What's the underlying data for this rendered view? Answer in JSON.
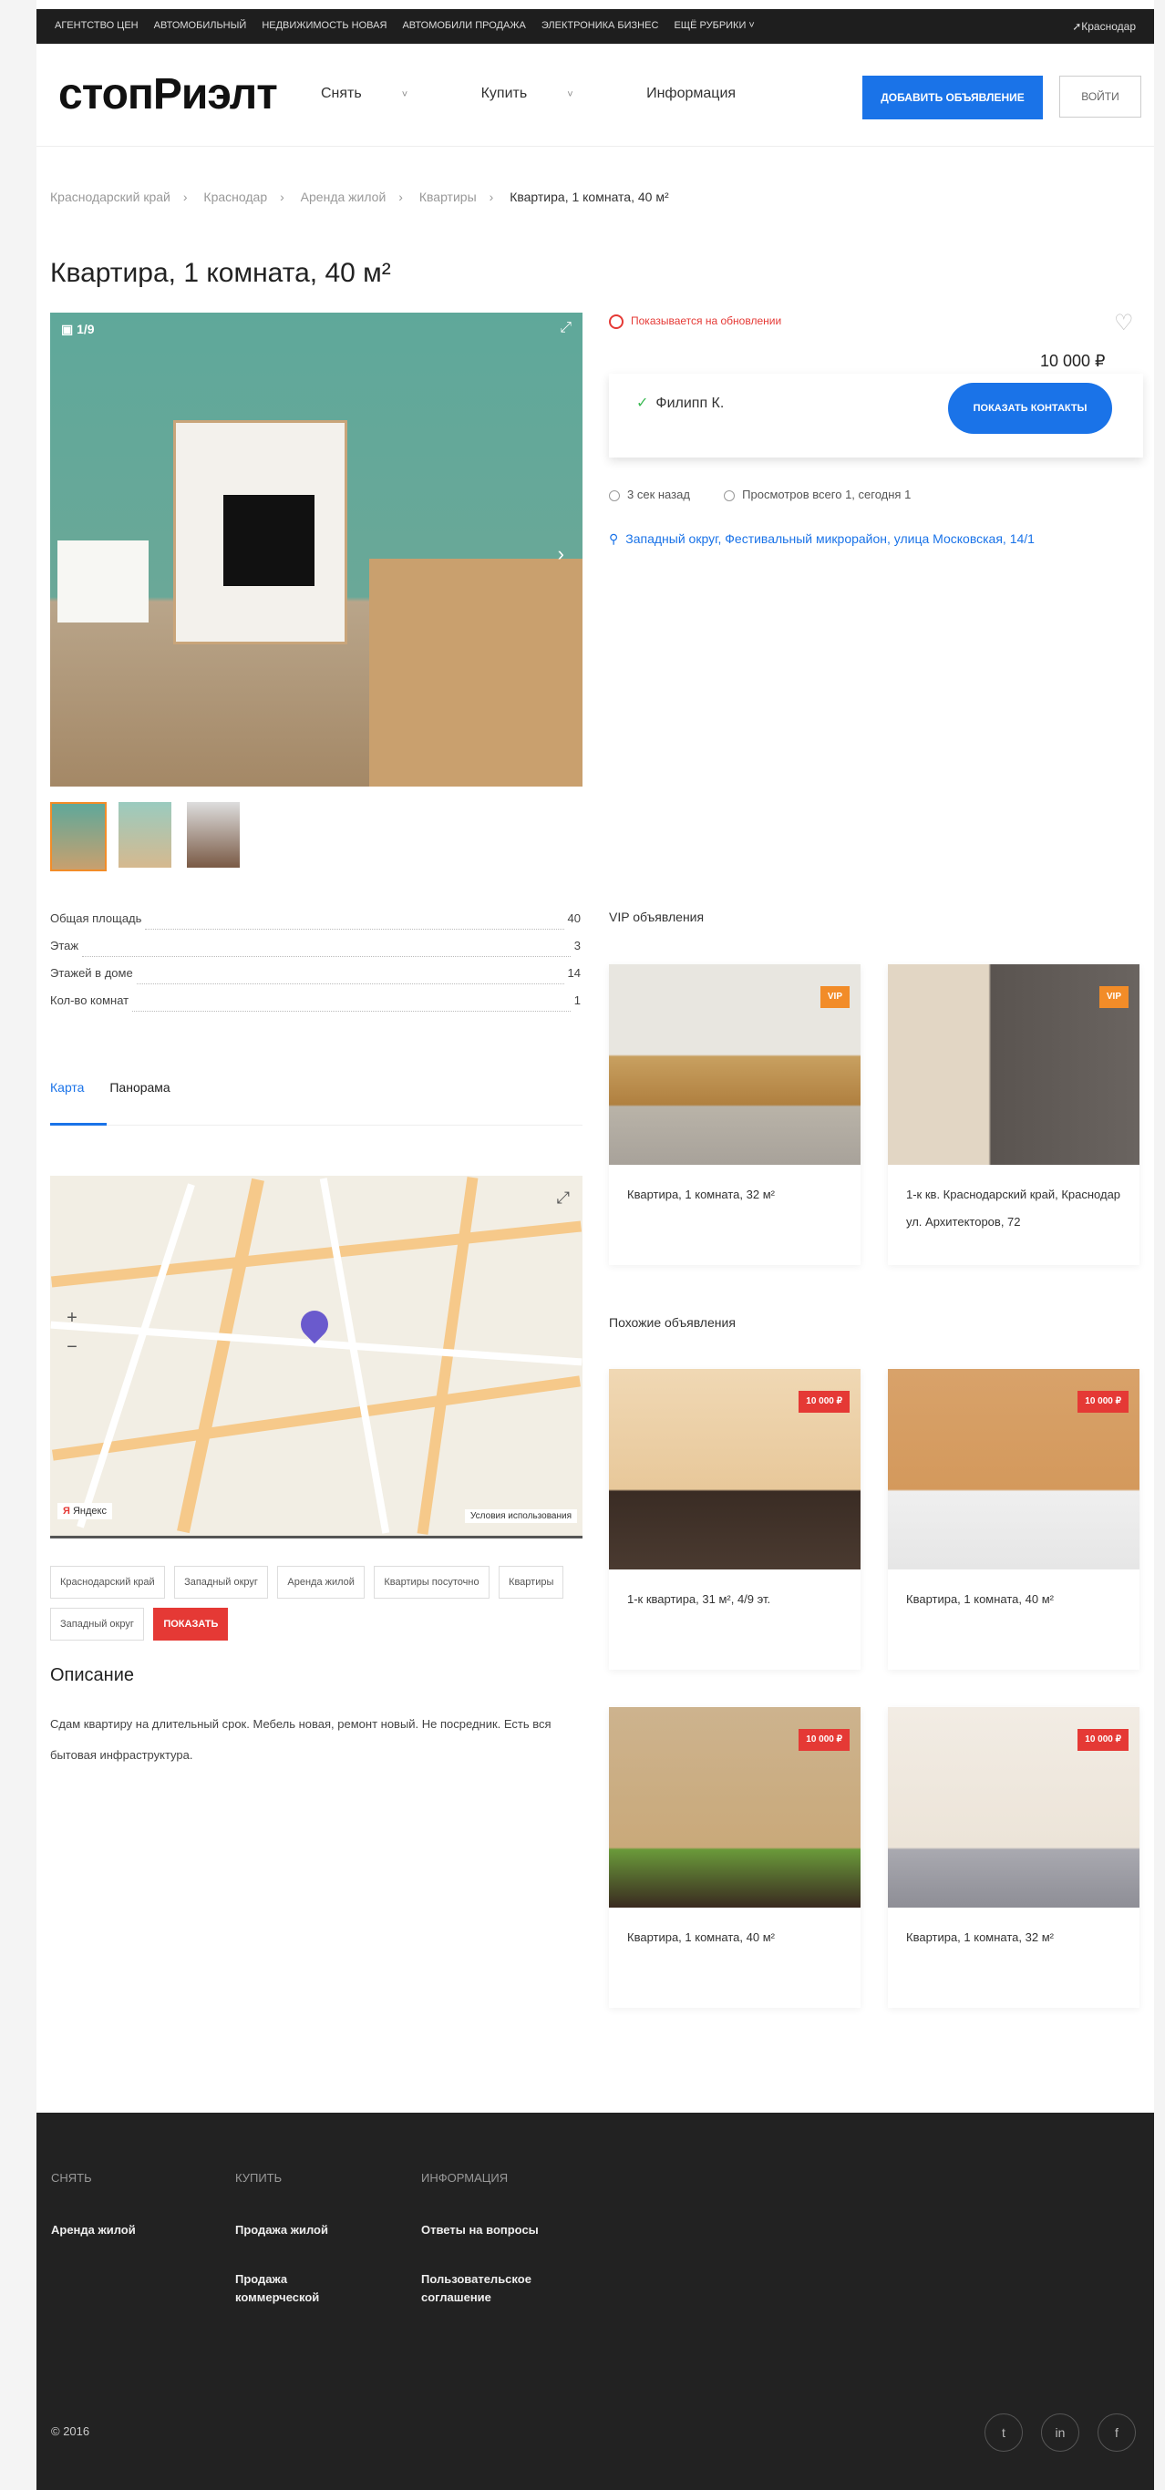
{
  "topbar": {
    "links": [
      "АГЕНТСТВО ЦЕН",
      "АВТОМОБИЛЬНЫЙ",
      "НЕДВИЖИМОСТЬ НОВАЯ",
      "АВТОМОБИЛИ ПРОДАЖА",
      "ЭЛЕКТРОНИКА БИЗНЕС",
      "ЕЩЁ РУБРИКИ ˅"
    ],
    "city": "Краснодар"
  },
  "header": {
    "logo": "стопРиэлт",
    "nav": [
      {
        "label": "Снять",
        "chevron": "˅"
      },
      {
        "label": "Купить",
        "chevron": "˅"
      },
      {
        "label": "Информация",
        "chevron": ""
      }
    ],
    "add_button": "ДОБАВИТЬ ОБЪЯВЛЕНИЕ",
    "login_button": "ВОЙТИ"
  },
  "breadcrumbs": [
    "Краснодарский край",
    "Краснодар",
    "Аренда жилой",
    "Квартиры",
    "Квартира, 1 комната, 40 м²"
  ],
  "listing": {
    "title": "Квартира, 1 комната, 40 м²",
    "photo_counter": "1/9",
    "status": "Показывается на обновлении",
    "price": "10 000 ₽",
    "seller": "Филипп К.",
    "contacts_button": "ПОКАЗАТЬ КОНТАКТЫ",
    "meta_views": "3 сек назад",
    "meta_published": "Просмотров всего 1, сегодня 1",
    "address": "Западный округ, Фестивальный микрорайон, улица Московская, 14/1"
  },
  "specs": [
    {
      "label": "Общая площадь",
      "value": "40"
    },
    {
      "label": "Этаж",
      "value": "3"
    },
    {
      "label": "Этажей в доме",
      "value": "14"
    },
    {
      "label": "Кол-во комнат",
      "value": "1"
    }
  ],
  "tabs": [
    "Карта",
    "Панорама"
  ],
  "map": {
    "yandex_label": "Яндекс",
    "terms": "Условия использования"
  },
  "tags": [
    "Краснодарский край",
    "Западный округ",
    "Аренда жилой",
    "Квартиры посуточно",
    "Квартиры",
    "Западный округ"
  ],
  "tag_action": "ПОКАЗАТЬ",
  "description": {
    "heading": "Описание",
    "text": "Сдам квартиру на длительный срок. Мебель новая, ремонт новый. Не посредник. Есть вся бытовая инфраструктура."
  },
  "vip": {
    "heading": "VIP объявления",
    "items": [
      {
        "badge": "VIP",
        "caption": "Квартира, 1 комната, 32 м²"
      },
      {
        "badge": "VIP",
        "caption": "1-к кв. Краснодарский край, Краснодар ул. Архитекторов, 72"
      }
    ]
  },
  "similar": {
    "heading": "Похожие объявления",
    "items": [
      {
        "badge": "10 000 ₽",
        "caption": "1-к квартира, 31 м², 4/9 эт."
      },
      {
        "badge": "10 000 ₽",
        "caption": "Квартира, 1 комната, 40 м²"
      },
      {
        "badge": "10 000 ₽",
        "caption": "Квартира, 1 комната, 40 м²"
      },
      {
        "badge": "10 000 ₽",
        "caption": "Квартира, 1 комната, 32 м²"
      }
    ]
  },
  "footer": {
    "cols": [
      {
        "heading": "СНЯТЬ",
        "links": [
          "Аренда жилой"
        ]
      },
      {
        "heading": "КУПИТЬ",
        "links": [
          "Продажа жилой",
          "Продажа коммерческой"
        ]
      },
      {
        "heading": "ИНФОРМАЦИЯ",
        "links": [
          "Ответы на вопросы",
          "Пользовательское соглашение"
        ]
      }
    ],
    "copyright": "© 2016",
    "social": [
      "t",
      "in",
      "f"
    ]
  }
}
